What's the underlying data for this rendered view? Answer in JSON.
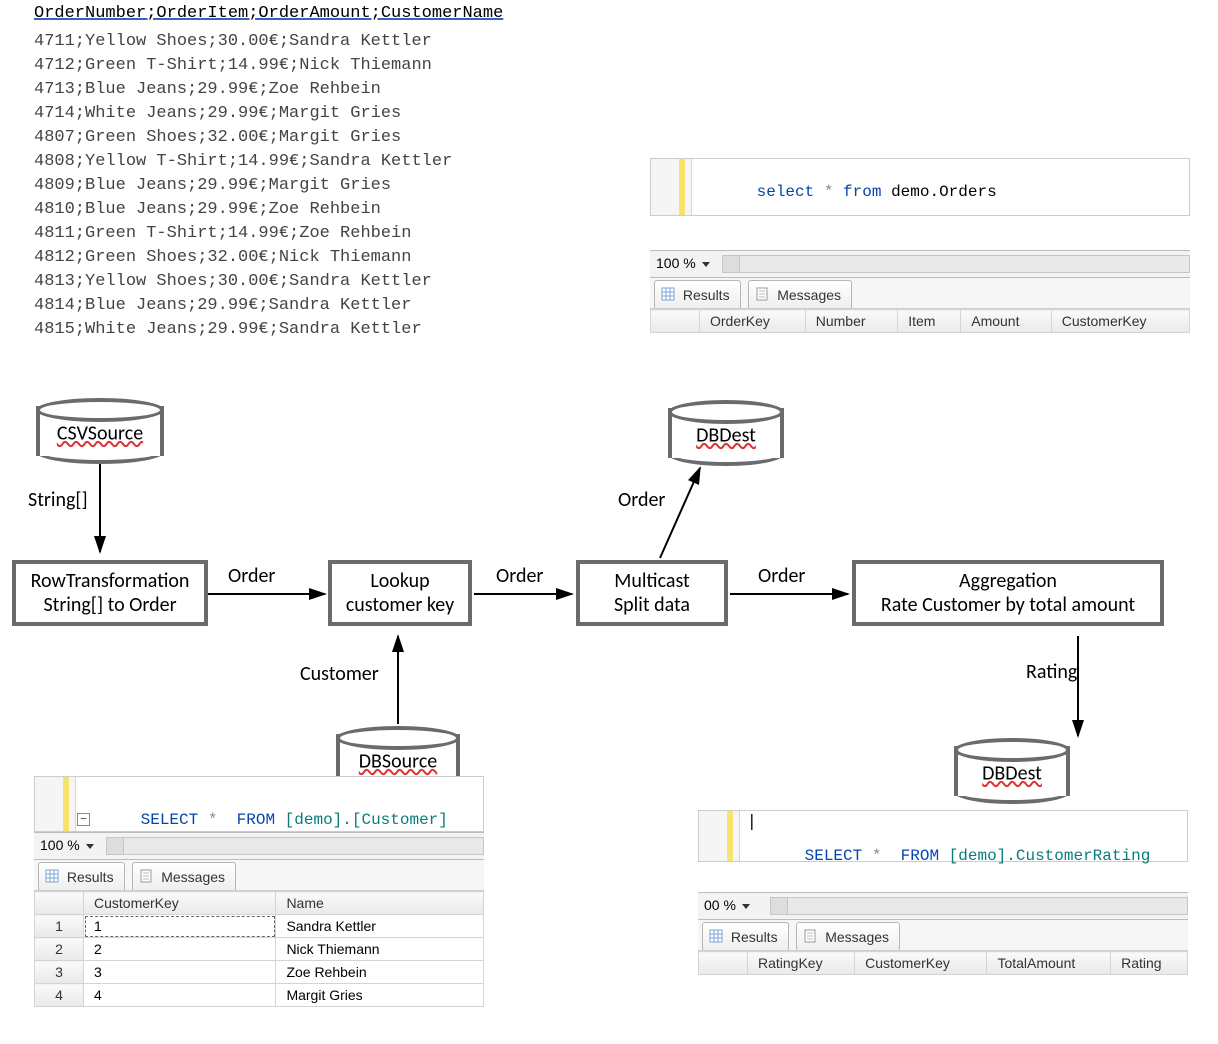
{
  "csv": {
    "header": "OrderNumber;OrderItem;OrderAmount;CustomerName",
    "rows": [
      "4711;Yellow Shoes;30.00€;Sandra Kettler",
      "4712;Green T-Shirt;14.99€;Nick Thiemann",
      "4713;Blue Jeans;29.99€;Zoe Rehbein",
      "4714;White Jeans;29.99€;Margit Gries",
      "4807;Green Shoes;32.00€;Margit Gries",
      "4808;Yellow T-Shirt;14.99€;Sandra Kettler",
      "4809;Blue Jeans;29.99€;Margit Gries",
      "4810;Blue Jeans;29.99€;Zoe Rehbein",
      "4811;Green T-Shirt;14.99€;Zoe Rehbein",
      "4812;Green Shoes;32.00€;Nick Thiemann",
      "4813;Yellow Shoes;30.00€;Sandra Kettler",
      "4814;Blue Jeans;29.99€;Sandra Kettler",
      "4815;White Jeans;29.99€;Sandra Kettler"
    ]
  },
  "nodes": {
    "csvsource": "CSVSource",
    "rowtransform_l1": "RowTransformation",
    "rowtransform_l2": "String[] to Order",
    "lookup_l1": "Lookup",
    "lookup_l2": "customer key",
    "dbsource": "DBSource",
    "multicast_l1": "Multicast",
    "multicast_l2": "Split data",
    "dbdest1": "DBDest",
    "agg_l1": "Aggregation",
    "agg_l2": "Rate Customer by total amount",
    "dbdest2": "DBDest"
  },
  "edges": {
    "e_csv_row": "String[]",
    "e_row_lookup": "Order",
    "e_dbsrc_lookup": "Customer",
    "e_lookup_multi": "Order",
    "e_multi_dbdest": "Order",
    "e_multi_agg": "Order",
    "e_agg_dbdest2": "Rating"
  },
  "sql_customer": {
    "pre": "SELECT *  FROM [demo].[Customer]",
    "kw1": "SELECT",
    "star": "*",
    "kw2": "FROM",
    "rest": "[demo].[Customer]",
    "zoom": "100 %",
    "tabs": {
      "results": "Results",
      "messages": "Messages"
    },
    "columns": [
      "",
      "CustomerKey",
      "Name"
    ],
    "rows": [
      [
        "1",
        "1",
        "Sandra Kettler"
      ],
      [
        "2",
        "2",
        "Nick Thiemann"
      ],
      [
        "3",
        "3",
        "Zoe Rehbein"
      ],
      [
        "4",
        "4",
        "Margit Gries"
      ]
    ]
  },
  "sql_orders": {
    "kw1": "select",
    "star": "*",
    "kw2": "from",
    "rest": "demo.Orders",
    "zoom": "100 %",
    "tabs": {
      "results": "Results",
      "messages": "Messages"
    },
    "columns": [
      "",
      "OrderKey",
      "Number",
      "Item",
      "Amount",
      "CustomerKey"
    ]
  },
  "sql_rating": {
    "kw1": "SELECT",
    "star": "*",
    "kw2": "FROM",
    "rest": "[demo].CustomerRating",
    "zoom": "00 %",
    "tabs": {
      "results": "Results",
      "messages": "Messages"
    },
    "columns": [
      "",
      "RatingKey",
      "CustomerKey",
      "TotalAmount",
      "Rating"
    ]
  }
}
